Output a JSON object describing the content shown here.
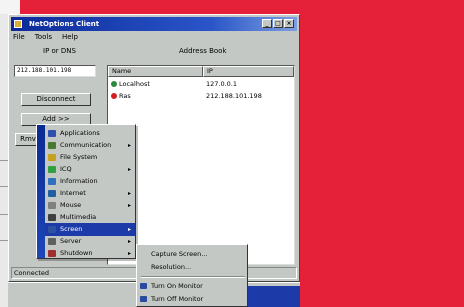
{
  "window": {
    "title": "NetOptions Client"
  },
  "menubar": {
    "file": "File",
    "tools": "Tools",
    "help": "Help"
  },
  "labels": {
    "ip_or_dns": "IP or DNS",
    "address_book": "Address Book"
  },
  "ip_input": {
    "value": "212.188.101.198"
  },
  "buttons": {
    "disconnect": "Disconnect",
    "add": "Add >>",
    "small": "Rmv"
  },
  "listview": {
    "columns": [
      "Name",
      "IP"
    ],
    "rows": [
      {
        "name": "Localhost",
        "ip": "127.0.0.1",
        "status_color": "#2a8a3a"
      },
      {
        "name": "Ras",
        "ip": "212.188.101.198",
        "status_color": "#d22020"
      }
    ]
  },
  "statusbar": {
    "text": "Connected"
  },
  "context_menu": {
    "items": [
      {
        "label": "Applications",
        "icon": "applications-icon",
        "has_submenu": false,
        "color": "#3050b0"
      },
      {
        "label": "Communication",
        "icon": "communication-icon",
        "has_submenu": true,
        "color": "#4a7a30"
      },
      {
        "label": "File System",
        "icon": "file-system-icon",
        "has_submenu": false,
        "color": "#c8a020"
      },
      {
        "label": "ICQ",
        "icon": "icq-icon",
        "has_submenu": true,
        "color": "#30a040"
      },
      {
        "label": "Information",
        "icon": "information-icon",
        "has_submenu": false,
        "color": "#3070c0"
      },
      {
        "label": "Internet",
        "icon": "internet-icon",
        "has_submenu": true,
        "color": "#2060a0"
      },
      {
        "label": "Mouse",
        "icon": "mouse-icon",
        "has_submenu": true,
        "color": "#808080"
      },
      {
        "label": "Multimedia",
        "icon": "multimedia-icon",
        "has_submenu": false,
        "color": "#404040"
      },
      {
        "label": "Screen",
        "icon": "screen-icon",
        "has_submenu": true,
        "color": "#3050a0",
        "highlighted": true
      },
      {
        "label": "Server",
        "icon": "server-icon",
        "has_submenu": true,
        "color": "#606060"
      },
      {
        "label": "Shutdown",
        "icon": "shutdown-icon",
        "has_submenu": true,
        "color": "#a03030"
      }
    ]
  },
  "submenu": {
    "items": [
      {
        "label": "Capture Screen...",
        "icon": ""
      },
      {
        "label": "Resolution...",
        "icon": ""
      },
      {
        "label": "",
        "separator": true
      },
      {
        "label": "Turn On Monitor",
        "icon": "monitor-on-icon"
      },
      {
        "label": "Turn Off Monitor",
        "icon": "monitor-off-icon"
      }
    ]
  }
}
